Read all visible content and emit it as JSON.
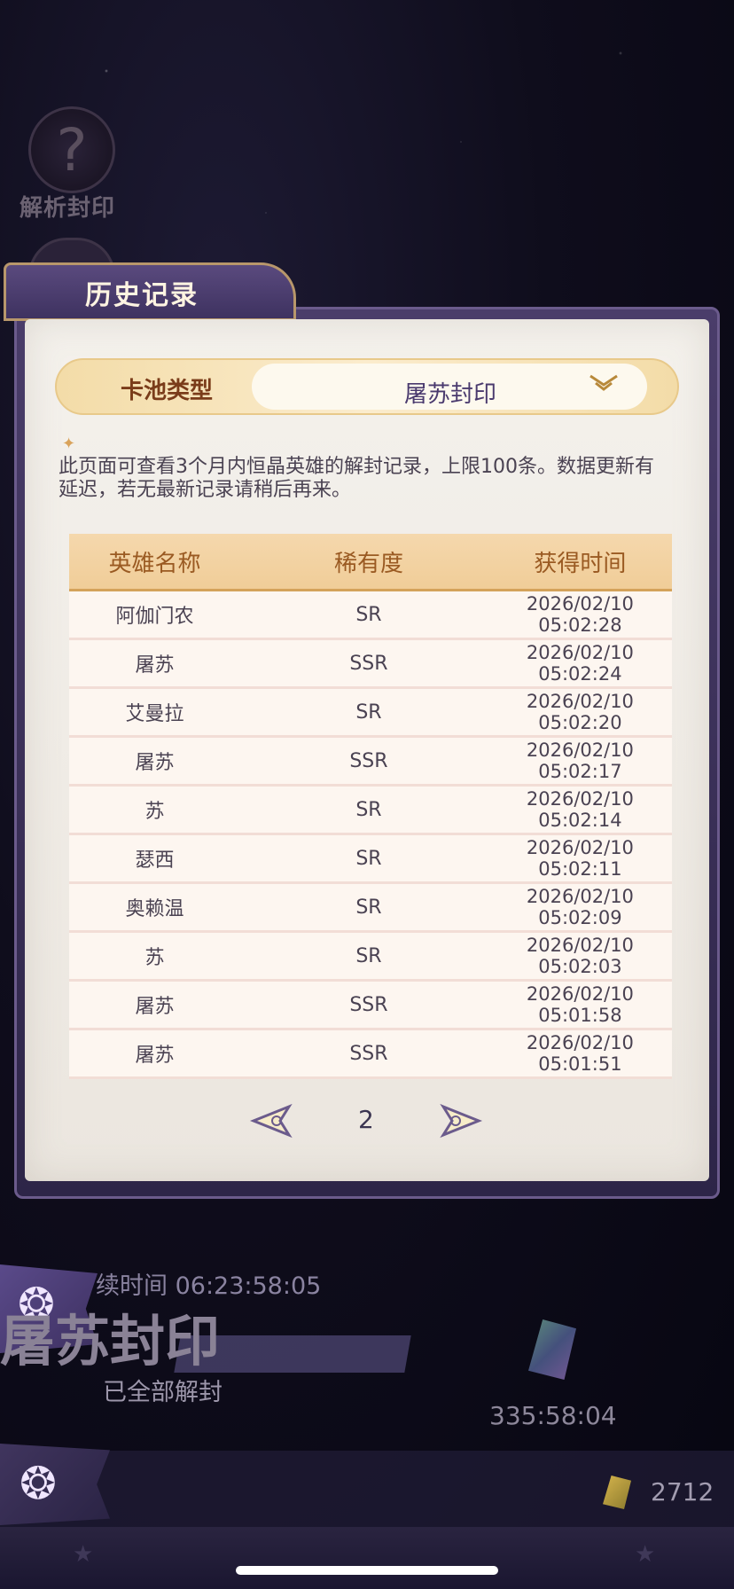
{
  "background": {
    "nav_label": "解析封印"
  },
  "panel": {
    "title": "历史记录",
    "pool_label": "卡池类型",
    "pool_value": "屠苏封印",
    "description": "此页面可查看3个月内恒晶英雄的解封记录，上限100条。数据更新有延迟，若无最新记录请稍后再来。"
  },
  "table": {
    "headers": [
      "英雄名称",
      "稀有度",
      "获得时间"
    ],
    "rows": [
      {
        "name": "阿伽门农",
        "rarity": "SR",
        "time": "2026/02/10 05:02:28"
      },
      {
        "name": "屠苏",
        "rarity": "SSR",
        "time": "2026/02/10 05:02:24"
      },
      {
        "name": "艾曼拉",
        "rarity": "SR",
        "time": "2026/02/10 05:02:20"
      },
      {
        "name": "屠苏",
        "rarity": "SSR",
        "time": "2026/02/10 05:02:17"
      },
      {
        "name": "苏",
        "rarity": "SR",
        "time": "2026/02/10 05:02:14"
      },
      {
        "name": "瑟西",
        "rarity": "SR",
        "time": "2026/02/10 05:02:11"
      },
      {
        "name": "奥赖温",
        "rarity": "SR",
        "time": "2026/02/10 05:02:09"
      },
      {
        "name": "苏",
        "rarity": "SR",
        "time": "2026/02/10 05:02:03"
      },
      {
        "name": "屠苏",
        "rarity": "SSR",
        "time": "2026/02/10 05:01:58"
      },
      {
        "name": "屠苏",
        "rarity": "SSR",
        "time": "2026/02/10 05:01:51"
      }
    ]
  },
  "pager": {
    "page": "2"
  },
  "game": {
    "countdown": "续时间 06:23:58:05",
    "pool_name": "屠苏封印",
    "status": "已全部解封",
    "gem_timer": "335:58:04",
    "currency": "2712"
  }
}
